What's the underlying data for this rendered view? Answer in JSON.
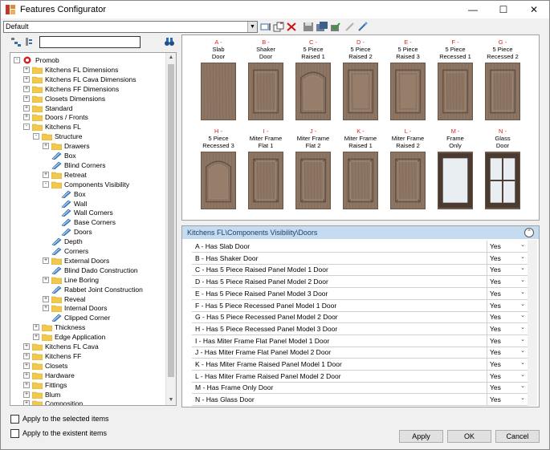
{
  "window": {
    "title": "Features Configurator",
    "minimize": "—",
    "maximize": "☐",
    "close": "✕"
  },
  "toolbar": {
    "profile_value": "Default"
  },
  "tree": {
    "nodes": [
      {
        "label": "Promob",
        "depth": 0,
        "expander": "-",
        "icon": "promob-icon"
      },
      {
        "label": "Kitchens FL Dimensions",
        "depth": 1,
        "expander": "+",
        "icon": "folder-icon"
      },
      {
        "label": "Kitchens FL Cava Dimensions",
        "depth": 1,
        "expander": "+",
        "icon": "folder-icon"
      },
      {
        "label": "Kitchens FF Dimensions",
        "depth": 1,
        "expander": "+",
        "icon": "folder-icon"
      },
      {
        "label": "Closets Dimensions",
        "depth": 1,
        "expander": "+",
        "icon": "folder-icon"
      },
      {
        "label": "Standard",
        "depth": 1,
        "expander": "+",
        "icon": "folder-icon"
      },
      {
        "label": "Doors / Fronts",
        "depth": 1,
        "expander": "+",
        "icon": "folder-icon"
      },
      {
        "label": "Kitchens FL",
        "depth": 1,
        "expander": "-",
        "icon": "folder-icon"
      },
      {
        "label": "Structure",
        "depth": 2,
        "expander": "-",
        "icon": "folder-icon"
      },
      {
        "label": "Drawers",
        "depth": 3,
        "expander": "+",
        "icon": "folder-icon"
      },
      {
        "label": "Box",
        "depth": 3,
        "expander": "",
        "icon": "tool-icon"
      },
      {
        "label": "Blind Corners",
        "depth": 3,
        "expander": "",
        "icon": "tool-icon"
      },
      {
        "label": "Retreat",
        "depth": 3,
        "expander": "+",
        "icon": "folder-icon"
      },
      {
        "label": "Components Visibility",
        "depth": 3,
        "expander": "-",
        "icon": "folder-icon"
      },
      {
        "label": "Box",
        "depth": 4,
        "expander": "",
        "icon": "tool-icon"
      },
      {
        "label": "Wall",
        "depth": 4,
        "expander": "",
        "icon": "tool-icon"
      },
      {
        "label": "Wall Corners",
        "depth": 4,
        "expander": "",
        "icon": "tool-icon"
      },
      {
        "label": "Base Corners",
        "depth": 4,
        "expander": "",
        "icon": "tool-icon"
      },
      {
        "label": "Doors",
        "depth": 4,
        "expander": "",
        "icon": "tool-icon"
      },
      {
        "label": "Depth",
        "depth": 3,
        "expander": "",
        "icon": "tool-icon"
      },
      {
        "label": "Corners",
        "depth": 3,
        "expander": "",
        "icon": "tool-icon"
      },
      {
        "label": "External Doors",
        "depth": 3,
        "expander": "+",
        "icon": "folder-icon"
      },
      {
        "label": "Blind Dado Construction",
        "depth": 3,
        "expander": "",
        "icon": "tool-icon"
      },
      {
        "label": "Line Boring",
        "depth": 3,
        "expander": "+",
        "icon": "folder-icon"
      },
      {
        "label": "Rabbet Joint Construction",
        "depth": 3,
        "expander": "",
        "icon": "tool-icon"
      },
      {
        "label": "Reveal",
        "depth": 3,
        "expander": "+",
        "icon": "folder-icon"
      },
      {
        "label": "Internal Doors",
        "depth": 3,
        "expander": "+",
        "icon": "folder-icon"
      },
      {
        "label": "Clipped Corner",
        "depth": 3,
        "expander": "",
        "icon": "tool-icon"
      },
      {
        "label": "Thickness",
        "depth": 2,
        "expander": "+",
        "icon": "folder-icon"
      },
      {
        "label": "Edge Application",
        "depth": 2,
        "expander": "+",
        "icon": "folder-icon"
      },
      {
        "label": "Kitchens FL Cava",
        "depth": 1,
        "expander": "+",
        "icon": "folder-icon"
      },
      {
        "label": "Kitchens FF",
        "depth": 1,
        "expander": "+",
        "icon": "folder-icon"
      },
      {
        "label": "Closets",
        "depth": 1,
        "expander": "+",
        "icon": "folder-icon"
      },
      {
        "label": "Hardware",
        "depth": 1,
        "expander": "+",
        "icon": "folder-icon"
      },
      {
        "label": "Fittings",
        "depth": 1,
        "expander": "+",
        "icon": "folder-icon"
      },
      {
        "label": "Blum",
        "depth": 1,
        "expander": "+",
        "icon": "folder-icon"
      },
      {
        "label": "Composition",
        "depth": 1,
        "expander": "+",
        "icon": "folder-icon"
      }
    ]
  },
  "doors": [
    {
      "letter": "A -",
      "name": [
        "Slab",
        "Door"
      ],
      "style": "slab"
    },
    {
      "letter": "B -",
      "name": [
        "Shaker",
        "Door"
      ],
      "style": "shaker"
    },
    {
      "letter": "C -",
      "name": [
        "5 Piece",
        "Raised 1"
      ],
      "style": "arch"
    },
    {
      "letter": "D -",
      "name": [
        "5 Piece",
        "Raised 2"
      ],
      "style": "raised"
    },
    {
      "letter": "E -",
      "name": [
        "5 Piece",
        "Raised 3"
      ],
      "style": "raised"
    },
    {
      "letter": "F -",
      "name": [
        "5 Piece",
        "Recessed 1"
      ],
      "style": "recessed"
    },
    {
      "letter": "G -",
      "name": [
        "5 Piece",
        "Recessed 2"
      ],
      "style": "recessed"
    },
    {
      "letter": "H -",
      "name": [
        "5 Piece",
        "Recessed 3"
      ],
      "style": "arch"
    },
    {
      "letter": "I -",
      "name": [
        "Miter Frame",
        "Flat 1"
      ],
      "style": "miter"
    },
    {
      "letter": "J -",
      "name": [
        "Miter Frame",
        "Flat 2"
      ],
      "style": "miter"
    },
    {
      "letter": "K -",
      "name": [
        "Miter Frame",
        "Raised 1"
      ],
      "style": "miter"
    },
    {
      "letter": "L -",
      "name": [
        "Miter Frame",
        "Raised 2"
      ],
      "style": "miter"
    },
    {
      "letter": "M -",
      "name": [
        "Frame",
        "Only"
      ],
      "style": "frame"
    },
    {
      "letter": "N -",
      "name": [
        "Glass",
        "Door"
      ],
      "style": "glass"
    }
  ],
  "props": {
    "header": "Kitchens FL\\Components Visibility\\Doors",
    "rows": [
      {
        "label": "A - Has Slab Door",
        "value": "Yes"
      },
      {
        "label": "B - Has Shaker Door",
        "value": "Yes"
      },
      {
        "label": "C - Has 5 Piece Raised Panel Model 1 Door",
        "value": "Yes"
      },
      {
        "label": "D - Has 5 Piece Raised Panel Model 2 Door",
        "value": "Yes"
      },
      {
        "label": "E - Has 5 Piece Raised Panel Model 3 Door",
        "value": "Yes"
      },
      {
        "label": "F - Has 5 Piece Recessed Panel Model 1 Door",
        "value": "Yes"
      },
      {
        "label": "G - Has 5 Piece Recessed Panel Model 2 Door",
        "value": "Yes"
      },
      {
        "label": "H - Has 5 Piece Recessed Panel Model 3 Door",
        "value": "Yes"
      },
      {
        "label": "I - Has Miter Frame Flat Panel Model 1 Door",
        "value": "Yes"
      },
      {
        "label": "J - Has Miter Frame Flat Panel Model 2 Door",
        "value": "Yes"
      },
      {
        "label": "K - Has Miter Frame Raised Panel Model 1 Door",
        "value": "Yes"
      },
      {
        "label": "L - Has Miter Frame Raised Panel Model 2 Door",
        "value": "Yes"
      },
      {
        "label": "M - Has Frame Only Door",
        "value": "Yes"
      },
      {
        "label": "N - Has Glass Door",
        "value": "Yes"
      }
    ]
  },
  "footer": {
    "apply_selected": "Apply to the selected items",
    "apply_existent": "Apply to the existent items",
    "apply": "Apply",
    "ok": "OK",
    "cancel": "Cancel"
  },
  "colors": {
    "accent_header": "#c5dbf0",
    "door_wood": "#8c7563",
    "door_letter": "#e02020"
  }
}
